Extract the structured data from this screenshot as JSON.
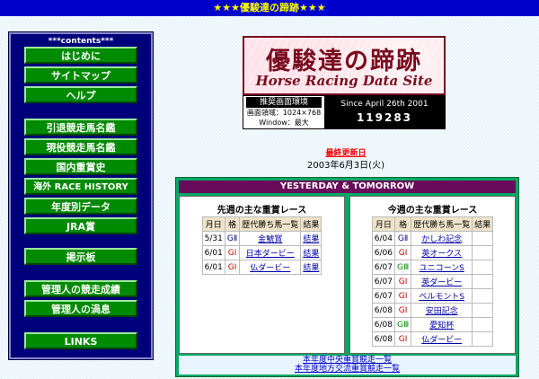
{
  "banner": {
    "text": "優駿達の蹄跡",
    "stars_left": "★★★",
    "stars_right": "★★★"
  },
  "sidebar": {
    "title": "***contents***",
    "items": [
      {
        "label": "はじめに"
      },
      {
        "label": "サイトマップ"
      },
      {
        "label": "ヘルプ"
      },
      {
        "label": "引退競走馬名鑑"
      },
      {
        "label": "現役競走馬名鑑"
      },
      {
        "label": "国内重賞史"
      },
      {
        "label": "海外 RACE HISTORY"
      },
      {
        "label": "年度別データ"
      },
      {
        "label": "JRA賞"
      },
      {
        "label": "掲示板"
      },
      {
        "label": "管理人の競走成績"
      },
      {
        "label": "管理人の渦息"
      },
      {
        "label": "LINKS"
      }
    ]
  },
  "logo": {
    "jp": "優駿達の蹄跡",
    "en": "Horse Racing Data Site",
    "color": "#7a0a1e"
  },
  "env": {
    "title": "推奨画面環境",
    "line1": "画面領域：1024×768",
    "line2": "Window：最大"
  },
  "since": {
    "text": "Since April 26th 2001",
    "counter": "119283"
  },
  "update": {
    "label": "最終更新日",
    "date": "2003年6月3日(火)"
  },
  "yt": {
    "header": "YESTERDAY & TOMORROW",
    "columns_headers": {
      "date": "月日",
      "grade": "格",
      "winner": "歴代勝ち馬一覧",
      "result": "結果"
    },
    "last_week": {
      "title": "先週の主な重賞レース",
      "rows": [
        {
          "date": "5/31",
          "grade": "GⅡ",
          "gclass": "g2",
          "name": "金鯱賞",
          "result": "結果"
        },
        {
          "date": "6/01",
          "grade": "GⅠ",
          "gclass": "g1",
          "name": "日本ダービー",
          "result": "結果"
        },
        {
          "date": "6/01",
          "grade": "GⅠ",
          "gclass": "g1",
          "name": "仏ダービー",
          "result": "結果"
        }
      ]
    },
    "this_week": {
      "title": "今週の主な重賞レース",
      "rows": [
        {
          "date": "6/04",
          "grade": "GⅡ",
          "gclass": "g2",
          "name": "かしわ記念",
          "result": ""
        },
        {
          "date": "6/06",
          "grade": "GⅠ",
          "gclass": "g1",
          "name": "英オークス",
          "result": ""
        },
        {
          "date": "6/07",
          "grade": "GⅢ",
          "gclass": "g3",
          "name": "ユニコーンS",
          "result": ""
        },
        {
          "date": "6/07",
          "grade": "GⅠ",
          "gclass": "g1",
          "name": "英ダービー",
          "result": ""
        },
        {
          "date": "6/07",
          "grade": "GⅠ",
          "gclass": "g1",
          "name": "ベルモントS",
          "result": ""
        },
        {
          "date": "6/08",
          "grade": "GⅠ",
          "gclass": "g1",
          "name": "安田記念",
          "result": ""
        },
        {
          "date": "6/08",
          "grade": "GⅢ",
          "gclass": "g3",
          "name": "愛知杯",
          "result": ""
        },
        {
          "date": "6/08",
          "grade": "GⅠ",
          "gclass": "g1",
          "name": "仏ダービー",
          "result": ""
        }
      ]
    },
    "footer": {
      "link1": "本年度中央重賞競走一覧",
      "link2": "本年度地方交流重賞競走一覧"
    }
  }
}
